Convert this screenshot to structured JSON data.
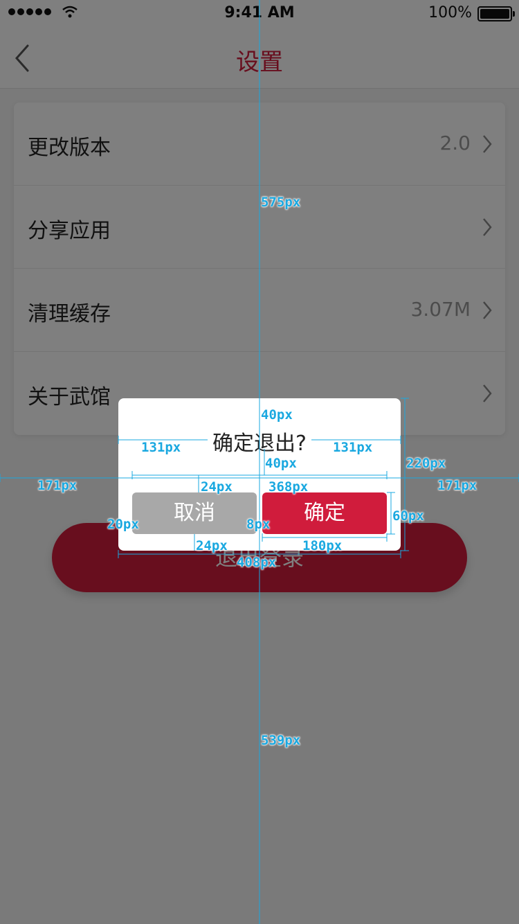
{
  "status_bar": {
    "time": "9:41 AM",
    "battery_pct": "100%"
  },
  "nav": {
    "title": "设置",
    "back_icon": "chevron-left-icon"
  },
  "settings": [
    {
      "label": "更改版本",
      "value": "2.0"
    },
    {
      "label": "分享应用",
      "value": ""
    },
    {
      "label": "清理缓存",
      "value": "3.07M"
    },
    {
      "label": "关于武馆",
      "value": ""
    }
  ],
  "logout_label": "退出登录",
  "dialog": {
    "title": "确定退出?",
    "cancel_label": "取消",
    "confirm_label": "确定"
  },
  "annotations": [
    "575px",
    "40px",
    "131px",
    "131px",
    "40px",
    "220px",
    "171px",
    "171px",
    "24px",
    "368px",
    "20px",
    "8px",
    "60px",
    "24px",
    "180px",
    "408px",
    "539px"
  ],
  "colors": {
    "accent": "#d01c3c",
    "cancel": "#a8a8a8",
    "annotation": "#1aa8e0"
  }
}
